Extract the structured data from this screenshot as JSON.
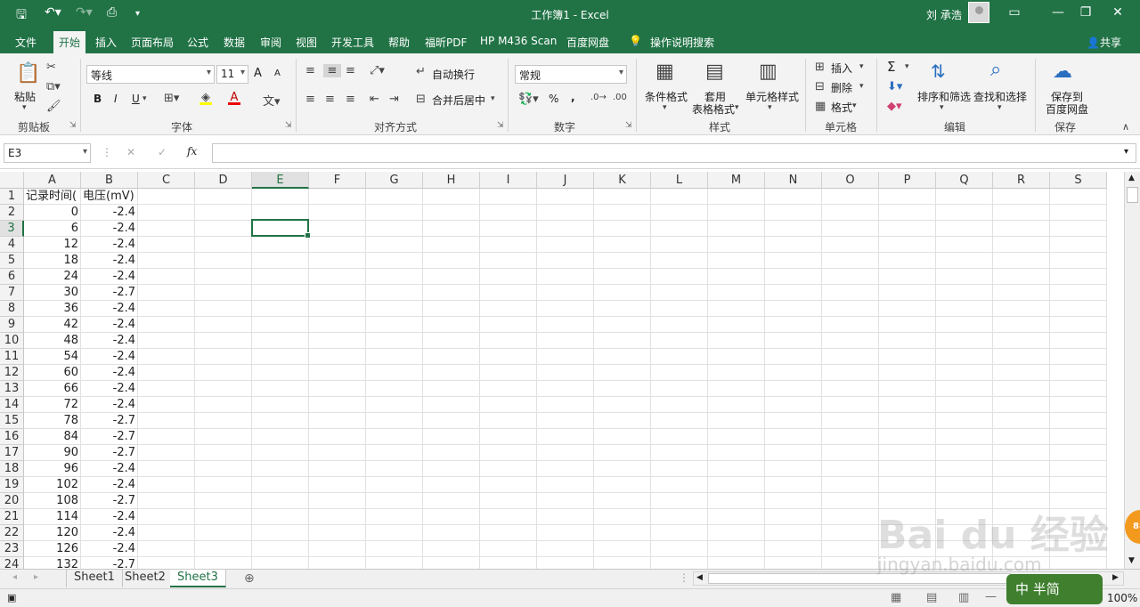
{
  "window": {
    "title": "工作簿1  -  Excel",
    "user": "刘 承浩"
  },
  "tabs": [
    "文件",
    "开始",
    "插入",
    "页面布局",
    "公式",
    "数据",
    "审阅",
    "视图",
    "开发工具",
    "帮助",
    "福昕PDF",
    "HP M436 Scan",
    "百度网盘"
  ],
  "tell_me": "操作说明搜索",
  "share": "共享",
  "ribbon": {
    "clipboard": {
      "paste": "粘贴",
      "label": "剪贴板"
    },
    "font": {
      "name": "等线",
      "size": "11",
      "bold": "B",
      "italic": "I",
      "underline": "U",
      "grow": "A",
      "shrink": "A",
      "label": "字体"
    },
    "alignment": {
      "wrap": "自动换行",
      "merge": "合并后居中",
      "label": "对齐方式"
    },
    "number": {
      "format": "常规",
      "percent": "%",
      "comma": ",",
      "label": "数字"
    },
    "styles": {
      "cond": "条件格式",
      "table1": "套用",
      "table2": "表格格式",
      "cell": "单元格样式",
      "label": "样式"
    },
    "cells": {
      "insert": "插入",
      "delete": "删除",
      "format": "格式",
      "label": "单元格"
    },
    "editing": {
      "sum": "Σ",
      "sort": "排序和筛选",
      "find": "查找和选择",
      "label": "编辑"
    },
    "save": {
      "line1": "保存到",
      "line2": "百度网盘",
      "label": "保存"
    }
  },
  "formula_bar": {
    "name_box": "E3",
    "fx": "fx",
    "cancel": "✕",
    "confirm": "✓",
    "formula": ""
  },
  "columns": [
    "A",
    "B",
    "C",
    "D",
    "E",
    "F",
    "G",
    "H",
    "I",
    "J",
    "K",
    "L",
    "M",
    "N",
    "O",
    "P",
    "Q",
    "R",
    "S"
  ],
  "rows": [
    {
      "n": "1",
      "a": "记录时间(",
      "b": "电压(mV)"
    },
    {
      "n": "2",
      "a": "0",
      "b": "-2.4"
    },
    {
      "n": "3",
      "a": "6",
      "b": "-2.4"
    },
    {
      "n": "4",
      "a": "12",
      "b": "-2.4"
    },
    {
      "n": "5",
      "a": "18",
      "b": "-2.4"
    },
    {
      "n": "6",
      "a": "24",
      "b": "-2.4"
    },
    {
      "n": "7",
      "a": "30",
      "b": "-2.7"
    },
    {
      "n": "8",
      "a": "36",
      "b": "-2.4"
    },
    {
      "n": "9",
      "a": "42",
      "b": "-2.4"
    },
    {
      "n": "10",
      "a": "48",
      "b": "-2.4"
    },
    {
      "n": "11",
      "a": "54",
      "b": "-2.4"
    },
    {
      "n": "12",
      "a": "60",
      "b": "-2.4"
    },
    {
      "n": "13",
      "a": "66",
      "b": "-2.4"
    },
    {
      "n": "14",
      "a": "72",
      "b": "-2.4"
    },
    {
      "n": "15",
      "a": "78",
      "b": "-2.7"
    },
    {
      "n": "16",
      "a": "84",
      "b": "-2.7"
    },
    {
      "n": "17",
      "a": "90",
      "b": "-2.7"
    },
    {
      "n": "18",
      "a": "96",
      "b": "-2.4"
    },
    {
      "n": "19",
      "a": "102",
      "b": "-2.4"
    },
    {
      "n": "20",
      "a": "108",
      "b": "-2.7"
    },
    {
      "n": "21",
      "a": "114",
      "b": "-2.4"
    },
    {
      "n": "22",
      "a": "120",
      "b": "-2.4"
    },
    {
      "n": "23",
      "a": "126",
      "b": "-2.4"
    },
    {
      "n": "24",
      "a": "132",
      "b": "-2.7"
    }
  ],
  "sheets": [
    "Sheet1",
    "Sheet2",
    "Sheet3"
  ],
  "active_sheet": "Sheet3",
  "zoom": "100%",
  "watermark": {
    "text": "Bai du 经验",
    "url": "jingyan.baidu.com",
    "badge": "中 半简",
    "orange": "88"
  },
  "colors": {
    "accent": "#217346"
  }
}
